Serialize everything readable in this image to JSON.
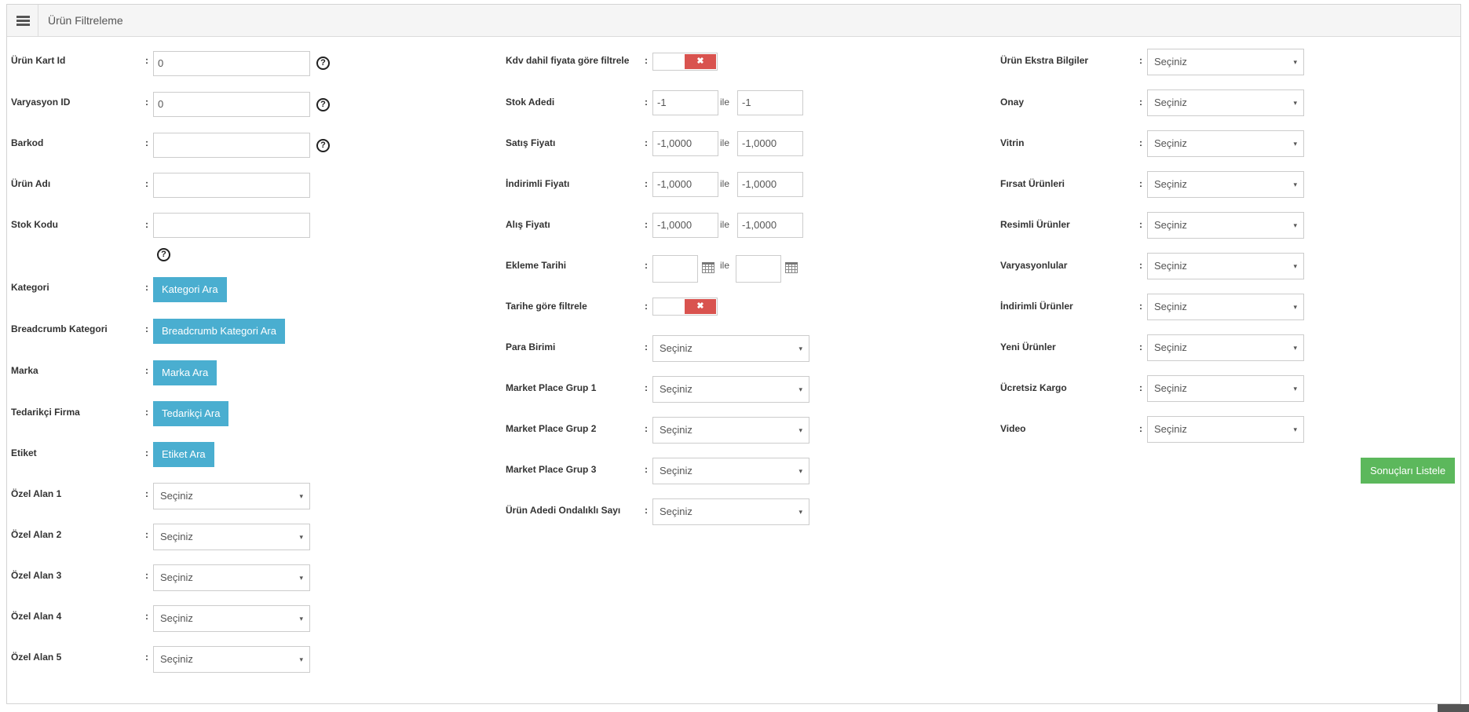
{
  "header": {
    "title": "Ürün Filtreleme",
    "menu_icon": "hamburger-menu-icon"
  },
  "common": {
    "colon": ":",
    "help_glyph": "?",
    "between": "ile",
    "select_caret": "▾",
    "toggle_off_glyph": "✖"
  },
  "left": {
    "urun_kart_id": {
      "label": "Ürün Kart Id",
      "value": "0"
    },
    "varyasyon_id": {
      "label": "Varyasyon ID",
      "value": "0"
    },
    "barkod": {
      "label": "Barkod",
      "value": ""
    },
    "urun_adi": {
      "label": "Ürün Adı",
      "value": ""
    },
    "stok_kodu": {
      "label": "Stok Kodu",
      "value": ""
    },
    "kategori": {
      "label": "Kategori",
      "button": "Kategori Ara"
    },
    "breadcrumb": {
      "label": "Breadcrumb Kategori",
      "button": "Breadcrumb Kategori Ara"
    },
    "marka": {
      "label": "Marka",
      "button": "Marka Ara"
    },
    "tedarikci": {
      "label": "Tedarikçi Firma",
      "button": "Tedarikçi Ara"
    },
    "etiket": {
      "label": "Etiket",
      "button": "Etiket Ara"
    },
    "ozel_alan_1": {
      "label": "Özel Alan 1",
      "value": "Seçiniz"
    },
    "ozel_alan_2": {
      "label": "Özel Alan 2",
      "value": "Seçiniz"
    },
    "ozel_alan_3": {
      "label": "Özel Alan 3",
      "value": "Seçiniz"
    },
    "ozel_alan_4": {
      "label": "Özel Alan 4",
      "value": "Seçiniz"
    },
    "ozel_alan_5": {
      "label": "Özel Alan 5",
      "value": "Seçiniz"
    }
  },
  "middle": {
    "kdv_toggle": {
      "label": "Kdv dahil fiyata göre filtrele"
    },
    "stok_adedi": {
      "label": "Stok Adedi",
      "min": "-1",
      "max": "-1"
    },
    "satis_fiyati": {
      "label": "Satış Fiyatı",
      "min": "-1,0000",
      "max": "-1,0000"
    },
    "indirimli_fiyati": {
      "label": "İndirimli Fiyatı",
      "min": "-1,0000",
      "max": "-1,0000"
    },
    "alis_fiyati": {
      "label": "Alış Fiyatı",
      "min": "-1,0000",
      "max": "-1,0000"
    },
    "ekleme_tarihi": {
      "label": "Ekleme Tarihi",
      "from": "",
      "to": ""
    },
    "tarih_toggle": {
      "label": "Tarihe göre filtrele"
    },
    "para_birimi": {
      "label": "Para Birimi",
      "value": "Seçiniz"
    },
    "mp_grup_1": {
      "label": "Market Place Grup 1",
      "value": "Seçiniz"
    },
    "mp_grup_2": {
      "label": "Market Place Grup 2",
      "value": "Seçiniz"
    },
    "mp_grup_3": {
      "label": "Market Place Grup 3",
      "value": "Seçiniz"
    },
    "urun_adedi_ondalikli": {
      "label": "Ürün Adedi Ondalıklı Sayı",
      "value": "Seçiniz"
    }
  },
  "right": {
    "urun_ekstra": {
      "label": "Ürün Ekstra Bilgiler",
      "value": "Seçiniz"
    },
    "onay": {
      "label": "Onay",
      "value": "Seçiniz"
    },
    "vitrin": {
      "label": "Vitrin",
      "value": "Seçiniz"
    },
    "firsat": {
      "label": "Fırsat Ürünleri",
      "value": "Seçiniz"
    },
    "resimli": {
      "label": "Resimli Ürünler",
      "value": "Seçiniz"
    },
    "varyasyonlular": {
      "label": "Varyasyonlular",
      "value": "Seçiniz"
    },
    "indirimli_urunler": {
      "label": "İndirimli Ürünler",
      "value": "Seçiniz"
    },
    "yeni_urunler": {
      "label": "Yeni Ürünler",
      "value": "Seçiniz"
    },
    "ucretsiz_kargo": {
      "label": "Ücretsiz Kargo",
      "value": "Seçiniz"
    },
    "video": {
      "label": "Video",
      "value": "Seçiniz"
    }
  },
  "actions": {
    "submit": "Sonuçları Listele"
  },
  "colors": {
    "info_button": "#4aaed0",
    "success_button": "#5cb85c",
    "toggle_off": "#d9534f",
    "header_bg": "#f5f5f5"
  }
}
